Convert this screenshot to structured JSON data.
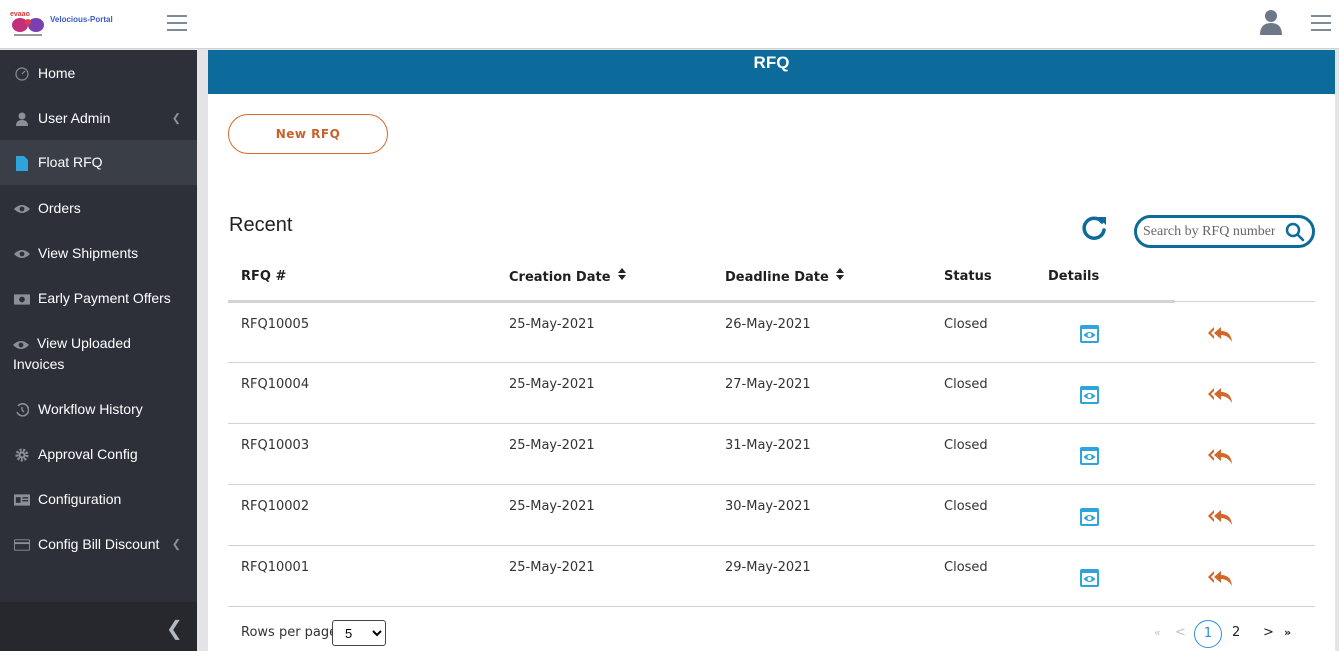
{
  "app": {
    "title": "Velocious-Portal"
  },
  "sidebar": {
    "items": [
      {
        "label": "Home",
        "icon": "dashboard-icon",
        "active": false,
        "submenu": false
      },
      {
        "label": "User Admin",
        "icon": "user-icon",
        "active": false,
        "submenu": true
      },
      {
        "label": "Float RFQ",
        "icon": "file-icon",
        "active": true,
        "submenu": false
      },
      {
        "label": "Orders",
        "icon": "eye-icon",
        "active": false,
        "submenu": false
      },
      {
        "label": "View Shipments",
        "icon": "eye-icon",
        "active": false,
        "submenu": false
      },
      {
        "label": "Early Payment Offers",
        "icon": "money-icon",
        "active": false,
        "submenu": false
      },
      {
        "label": "View Uploaded Invoices",
        "icon": "eye-icon",
        "active": false,
        "submenu": false
      },
      {
        "label": "Workflow History",
        "icon": "history-icon",
        "active": false,
        "submenu": false
      },
      {
        "label": "Approval Config",
        "icon": "gear-icon",
        "active": false,
        "submenu": false
      },
      {
        "label": "Configuration",
        "icon": "id-card-icon",
        "active": false,
        "submenu": false
      },
      {
        "label": "Config Bill Discount",
        "icon": "credit-card-icon",
        "active": false,
        "submenu": true
      }
    ]
  },
  "page": {
    "title": "RFQ",
    "new_button": "New RFQ",
    "section_title": "Recent",
    "search_placeholder": "Search by RFQ number"
  },
  "table": {
    "columns": [
      "RFQ #",
      "Creation Date",
      "Deadline Date",
      "Status",
      "Details",
      ""
    ],
    "rows": [
      {
        "rfq": "RFQ10005",
        "created": "25-May-2021",
        "deadline": "26-May-2021",
        "status": "Closed"
      },
      {
        "rfq": "RFQ10004",
        "created": "25-May-2021",
        "deadline": "27-May-2021",
        "status": "Closed"
      },
      {
        "rfq": "RFQ10003",
        "created": "25-May-2021",
        "deadline": "31-May-2021",
        "status": "Closed"
      },
      {
        "rfq": "RFQ10002",
        "created": "25-May-2021",
        "deadline": "30-May-2021",
        "status": "Closed"
      },
      {
        "rfq": "RFQ10001",
        "created": "25-May-2021",
        "deadline": "29-May-2021",
        "status": "Closed"
      }
    ]
  },
  "pagination": {
    "rows_label": "Rows per page",
    "rows_value": "5",
    "first": "«",
    "prev": "<",
    "pages": [
      "1",
      "2"
    ],
    "current": "1",
    "next": ">",
    "last": "»"
  },
  "colors": {
    "brand": "#0c6b9a",
    "accent": "#d2672b",
    "sidebar": "#2d3038",
    "eye": "#2ea3dc"
  }
}
